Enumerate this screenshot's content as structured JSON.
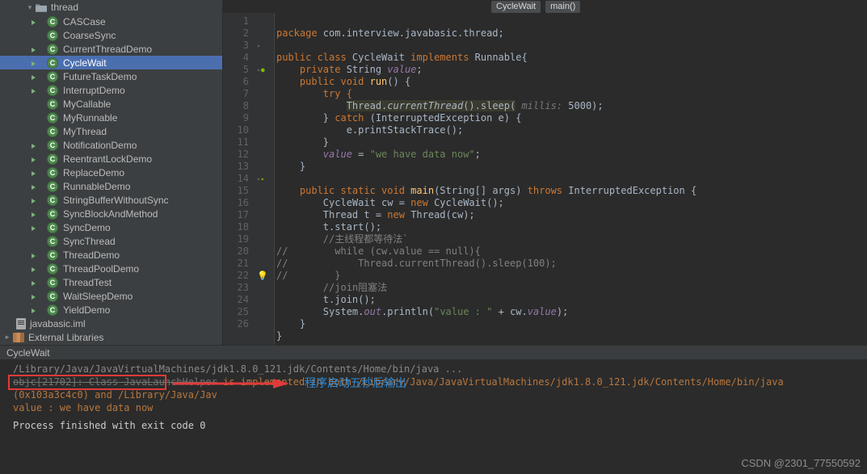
{
  "sidebar": {
    "folder": {
      "name": "thread"
    },
    "items": [
      {
        "label": "CASCase",
        "run": true
      },
      {
        "label": "CoarseSync",
        "run": false
      },
      {
        "label": "CurrentThreadDemo",
        "run": true
      },
      {
        "label": "CycleWait",
        "run": true,
        "selected": true
      },
      {
        "label": "FutureTaskDemo",
        "run": true
      },
      {
        "label": "InterruptDemo",
        "run": true
      },
      {
        "label": "MyCallable",
        "run": false
      },
      {
        "label": "MyRunnable",
        "run": false
      },
      {
        "label": "MyThread",
        "run": false
      },
      {
        "label": "NotificationDemo",
        "run": true
      },
      {
        "label": "ReentrantLockDemo",
        "run": true
      },
      {
        "label": "ReplaceDemo",
        "run": true
      },
      {
        "label": "RunnableDemo",
        "run": true
      },
      {
        "label": "StringBufferWithoutSync",
        "run": true
      },
      {
        "label": "SyncBlockAndMethod",
        "run": true
      },
      {
        "label": "SyncDemo",
        "run": true
      },
      {
        "label": "SyncThread",
        "run": false
      },
      {
        "label": "ThreadDemo",
        "run": true
      },
      {
        "label": "ThreadPoolDemo",
        "run": true
      },
      {
        "label": "ThreadTest",
        "run": true
      },
      {
        "label": "WaitSleepDemo",
        "run": true
      },
      {
        "label": "YieldDemo",
        "run": true
      }
    ],
    "rootFile": "javabasic.iml",
    "externalLibs": "External Libraries"
  },
  "breadcrumb": {
    "class": "CycleWait",
    "method": "main()"
  },
  "code": {
    "lines": [
      "1",
      "2",
      "3",
      "4",
      "5",
      "6",
      "7",
      "8",
      "9",
      "10",
      "11",
      "12",
      "13",
      "14",
      "15",
      "16",
      "17",
      "18",
      "19",
      "20",
      "21",
      "22",
      "23",
      "24",
      "25",
      "26"
    ],
    "l1_kw": "package ",
    "l1_rest": "com.interview.javabasic.thread;",
    "l3_a": "public class ",
    "l3_b": "CycleWait ",
    "l3_c": "implements ",
    "l3_d": "Runnable{",
    "l4_a": "    private ",
    "l4_b": "String ",
    "l4_c": "value",
    "l4_d": ";",
    "l5_a": "    public void ",
    "l5_b": "run",
    "l5_c": "() {",
    "l6": "        try {",
    "l7_a": "            ",
    "l7_b": "Thread.",
    "l7_c": "currentThread",
    "l7_d": "().sleep(",
    "l7_hint": " millis: ",
    "l7_e": "5000",
    "l7_f": ");",
    "l8_a": "        } ",
    "l8_b": "catch ",
    "l8_c": "(InterruptedException e) {",
    "l9_a": "            e.printStackTrace();",
    "l10": "        }",
    "l11_a": "        ",
    "l11_c": "value ",
    "l11_b": "= ",
    "l11_str": "\"we have data now\"",
    "l11_d": ";",
    "l12": "    }",
    "l14_a": "    public static void ",
    "l14_b": "main",
    "l14_c": "(String[] args) ",
    "l14_d": "throws ",
    "l14_e": "InterruptedException {",
    "l15_a": "        CycleWait cw = ",
    "l15_b": "new ",
    "l15_c": "CycleWait();",
    "l16_a": "        Thread t = ",
    "l16_b": "new ",
    "l16_c": "Thread(cw);",
    "l17": "        t.start();",
    "l18": "        //主线程都等待法`",
    "l19": "//        while (cw.value == null){",
    "l20": "//            Thread.currentThread().sleep(100);",
    "l21": "//        }",
    "l22": "        //join阻塞法",
    "l23": "        t.join();",
    "l24_a": "        System.",
    "l24_b": "out",
    "l24_c": ".println(",
    "l24_str": "\"value : \"",
    "l24_d": " + cw.",
    "l24_e": "value",
    "l24_f": ");",
    "l25": "    }",
    "l26": "}"
  },
  "runTab": "CycleWait",
  "console": {
    "cmd": "/Library/Java/JavaVirtualMachines/jdk1.8.0_121.jdk/Contents/Home/bin/java ...",
    "warn_a": "objc[21702]: Class JavaLaunchHelper",
    "warn_b": " is implemented in both /Library/Java/JavaVirtualMachines/jdk1.8.0_121.jdk/Contents/Home/bin/java (0x103a3c4c0) and /Library/Java/Jav",
    "out": "value : we have data now",
    "exit": "Process finished with exit code 0"
  },
  "annotation": "程序启动五秒后输出",
  "watermark": "CSDN @2301_77550592"
}
